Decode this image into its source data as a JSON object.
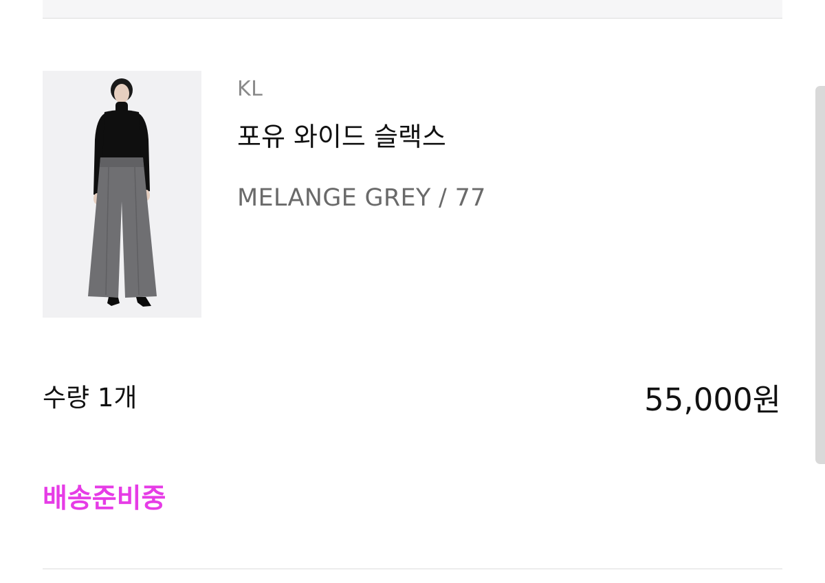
{
  "order_item": {
    "brand": "KL",
    "product_name": "포유 와이드 슬랙스",
    "option": "MELANGE GREY / 77",
    "quantity": "수량 1개",
    "price": "55,000원",
    "status": "배송준비중"
  },
  "colors": {
    "status": "#e63ce6",
    "text_primary": "#111111",
    "text_secondary": "#6a6a6a",
    "brand_text": "#8a8a8a",
    "divider": "#dcdcdc"
  }
}
